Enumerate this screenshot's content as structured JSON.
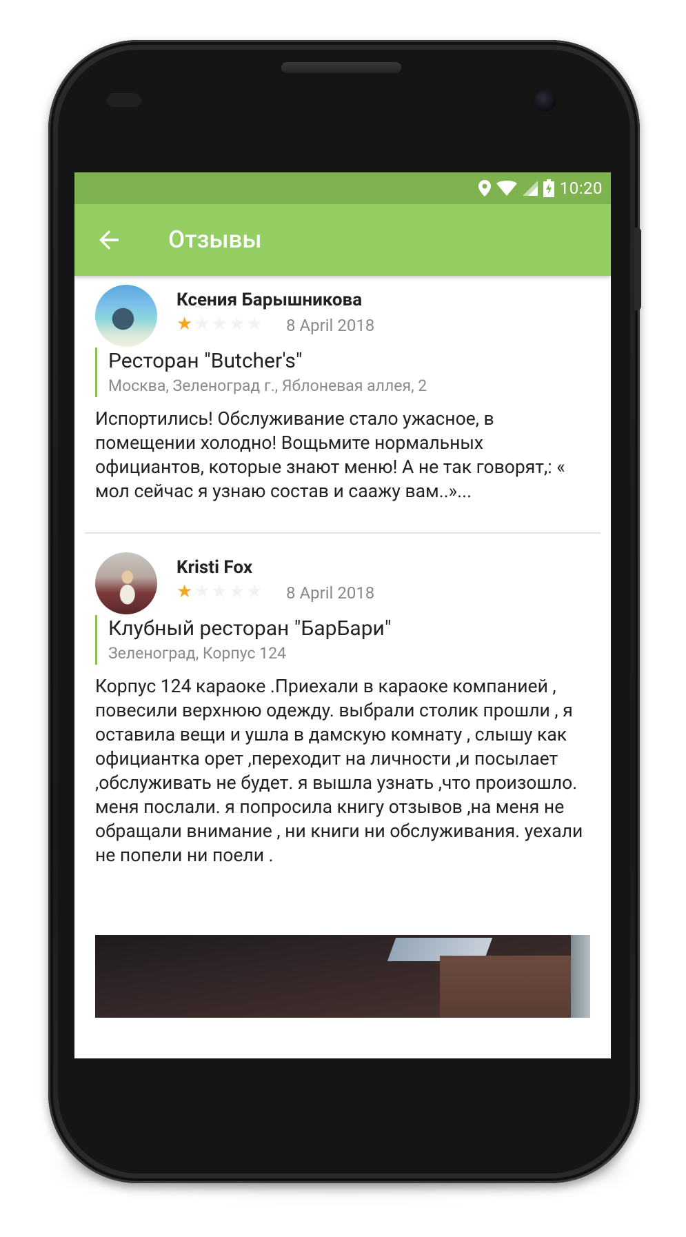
{
  "status_bar": {
    "time": "10:20",
    "icons": [
      "location-icon",
      "wifi-icon",
      "signal-icon",
      "battery-charging-icon"
    ]
  },
  "app_bar": {
    "title": "Отзывы",
    "back_icon": "arrow-back-icon"
  },
  "colors": {
    "status_bar": "#7fb34f",
    "app_bar": "#94cd62",
    "accent_border": "#8cc152",
    "star_on": "#f5a623",
    "star_off": "#f2f2f2"
  },
  "reviews": [
    {
      "author": "Ксения Барышникова",
      "rating": 1,
      "rating_max": 5,
      "date": "8 April 2018",
      "place_name": "Ресторан \"Butcher's\"",
      "place_address": "Москва, Зеленоград г., Яблоневая аллея, 2",
      "text": "Испортились! Обслуживание стало ужасное, в помещении холодно! Вощьмите нормальных официантов, которые знают меню! А не так говорят,: « мол сейчас я узнаю состав и саажу вам..»..."
    },
    {
      "author": "Kristi Fox",
      "rating": 1,
      "rating_max": 5,
      "date": "8 April 2018",
      "place_name": "Клубный ресторан \"БарБари\"",
      "place_address": "Зеленоград, Корпус 124",
      "text": "Корпус 124 караоке .Приехали в караоке компанией , повесили верхнюю одежду. выбрали столик прошли , я оставила вещи и ушла в дамскую комнату , слышу как официантка орет ,переходит на личности ,и посылает ,обслуживать не будет. я вышла узнать ,что произошло. меня послали. я попросила книгу отзывов ,на меня не обращали внимание , ни книги ни обслуживания. уехали не попели ни поели ."
    }
  ]
}
